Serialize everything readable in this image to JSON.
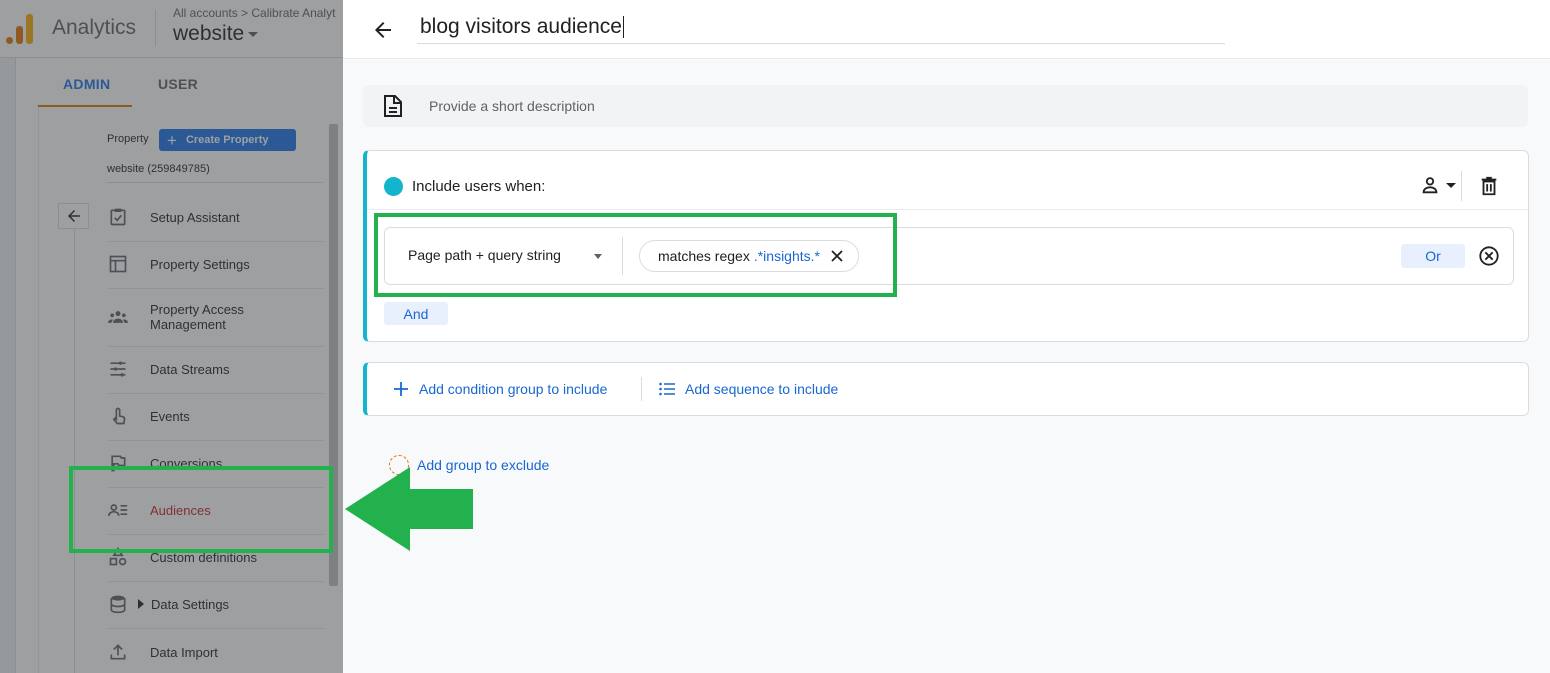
{
  "header": {
    "app_name": "Analytics",
    "breadcrumb": "All accounts > Calibrate Analyt",
    "property": "website"
  },
  "tabs": {
    "admin": "ADMIN",
    "user": "USER"
  },
  "property_panel": {
    "label": "Property",
    "create_button": "Create Property",
    "property_id": "website (259849785)"
  },
  "nav": {
    "items": [
      {
        "label": "Setup Assistant",
        "icon": "clipboard-check-icon"
      },
      {
        "label": "Property Settings",
        "icon": "layout-icon"
      },
      {
        "label": "Property Access Management",
        "icon": "people-icon"
      },
      {
        "label": "Data Streams",
        "icon": "streams-icon"
      },
      {
        "label": "Events",
        "icon": "touch-icon"
      },
      {
        "label": "Conversions",
        "icon": "flag-icon"
      },
      {
        "label": "Audiences",
        "icon": "audience-list-icon",
        "active": true
      },
      {
        "label": "Custom definitions",
        "icon": "shapes-icon"
      },
      {
        "label": "Data Settings",
        "icon": "database-icon"
      },
      {
        "label": "Data Import",
        "icon": "upload-icon"
      }
    ]
  },
  "editor": {
    "title": "blog visitors audience",
    "description_placeholder": "Provide a short description",
    "include_label": "Include users when:",
    "condition": {
      "dimension": "Page path + query string",
      "operator": "matches regex",
      "value": ".*insights.*"
    },
    "or_label": "Or",
    "and_label": "And",
    "add_condition_group": "Add condition group to include",
    "add_sequence": "Add sequence to include",
    "add_exclude": "Add group to exclude"
  },
  "colors": {
    "accent": "#1a73e8",
    "include_teal": "#12b5cb",
    "active_nav": "#c5221f",
    "annotation_green": "#22b14c"
  }
}
